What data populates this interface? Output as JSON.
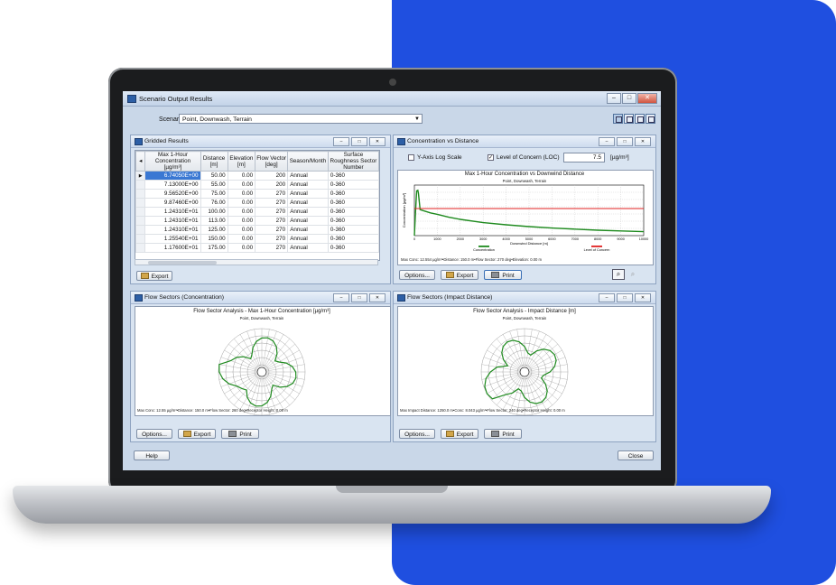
{
  "window": {
    "title": "Scenario Output Results",
    "min": "–",
    "max": "□",
    "close": "✕"
  },
  "scenario": {
    "label": "Scenario:",
    "value": "Point, Downwash, Terrain"
  },
  "gridded": {
    "title": "Gridded Results",
    "headers": [
      "Max 1-Hour Concentration [µg/m³]",
      "Distance [m]",
      "Elevation [m]",
      "Flow Vector [deg]",
      "Season/Month",
      "Surface Roughness Sector Number"
    ],
    "rows": [
      [
        "6.74050E+00",
        "50.00",
        "0.00",
        "200",
        "Annual",
        "0-360"
      ],
      [
        "7.13000E+00",
        "55.00",
        "0.00",
        "200",
        "Annual",
        "0-360"
      ],
      [
        "9.56520E+00",
        "75.00",
        "0.00",
        "270",
        "Annual",
        "0-360"
      ],
      [
        "9.87460E+00",
        "76.00",
        "0.00",
        "270",
        "Annual",
        "0-360"
      ],
      [
        "1.24310E+01",
        "100.00",
        "0.00",
        "270",
        "Annual",
        "0-360"
      ],
      [
        "1.24310E+01",
        "113.00",
        "0.00",
        "270",
        "Annual",
        "0-360"
      ],
      [
        "1.24310E+01",
        "125.00",
        "0.00",
        "270",
        "Annual",
        "0-360"
      ],
      [
        "1.25540E+01",
        "150.00",
        "0.00",
        "270",
        "Annual",
        "0-360"
      ],
      [
        "1.17600E+01",
        "175.00",
        "0.00",
        "270",
        "Annual",
        "0-360"
      ]
    ],
    "export": "Export"
  },
  "cvd": {
    "title": "Concentration vs Distance",
    "log_label": "Y-Axis Log Scale",
    "loc_label": "Level of Concern (LOC)",
    "loc_value": "7.5",
    "loc_unit": "[µg/m³]",
    "options": "Options...",
    "export": "Export",
    "print": "Print",
    "note": "Max Conc: 12.554 µg/m³•Distance: 150.0 m•Flow Sector: 270 deg•Elevation: 0.00 m"
  },
  "chart_data": {
    "type": "line",
    "title": "Max 1-Hour Concentration vs Downwind Distance",
    "subtitle": "Point, Downwash, Terrain",
    "xlabel": "Downwind Distance [m]",
    "ylabel": "Concentration [µg/m³]",
    "xlim": [
      0,
      10000
    ],
    "ylim": [
      0,
      14
    ],
    "x_ticks": [
      "0",
      "1000",
      "2000",
      "3000",
      "4000",
      "5000",
      "6000",
      "7000",
      "8000",
      "9000",
      "10000"
    ],
    "grid": true,
    "legend_position": "bottom",
    "series": [
      {
        "name": "Concentration",
        "color": "#1e8a1e",
        "x": [
          0,
          50,
          75,
          100,
          150,
          175,
          250,
          400,
          700,
          1000,
          1500,
          2000,
          3000,
          4000,
          5000,
          6000,
          7000,
          8000,
          9000,
          10000
        ],
        "y": [
          0,
          6.7,
          9.6,
          12.4,
          12.55,
          11.8,
          7.2,
          6.9,
          6.3,
          5.9,
          5.1,
          4.5,
          3.6,
          3.0,
          2.5,
          2.1,
          1.8,
          1.5,
          1.3,
          1.1
        ]
      },
      {
        "name": "Level of Concern",
        "color": "#e02020",
        "x": [
          0,
          10000
        ],
        "y": [
          7.5,
          7.5
        ]
      }
    ]
  },
  "fsc": {
    "title": "Flow Sectors (Concentration)",
    "chart_title": "Flow Sector Analysis - Max 1-Hour Concentration [µg/m³]",
    "chart_sub": "Point, Downwash, Terrain",
    "note": "Max Conc: 12.55 µg/m³•Distance: 150.0 m•Flow Sector: 260 deg•Receptor Height: 0.00 m",
    "options": "Options...",
    "export": "Export",
    "print": "Print"
  },
  "fsi": {
    "title": "Flow Sectors (Impact Distance)",
    "chart_title": "Flow Sector Analysis - Impact Distance [m]",
    "chart_sub": "Point, Downwash, Terrain",
    "note": "Max Impact Distance: 1250.0 m•Conc: 8.043 µg/m³•Flow Sector: 240 deg•Receptor Height: 0.00 m",
    "options": "Options...",
    "export": "Export",
    "print": "Print"
  },
  "bottom": {
    "help": "Help",
    "close": "Close"
  },
  "colors": {
    "brand_blue": "#1f4fe0",
    "series_green": "#1e8a1e",
    "loc_red": "#e02020"
  }
}
